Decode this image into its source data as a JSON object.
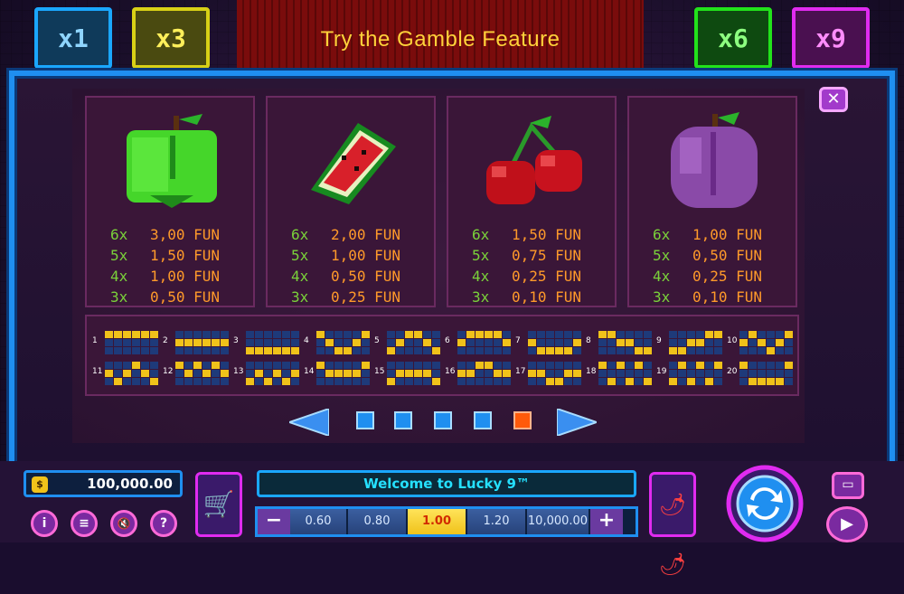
{
  "banner": {
    "text": "Try the Gamble Feature"
  },
  "multipliers": [
    {
      "label": "x1",
      "color": "#1aa7ff"
    },
    {
      "label": "x3",
      "color": "#d8d016"
    },
    {
      "label": "x6",
      "color": "#22e21b"
    },
    {
      "label": "x9",
      "color": "#e02bf0"
    }
  ],
  "symbols": [
    {
      "name": "green-apple",
      "pays": [
        {
          "count": "6x",
          "amount": "3,00 FUN"
        },
        {
          "count": "5x",
          "amount": "1,50 FUN"
        },
        {
          "count": "4x",
          "amount": "1,00 FUN"
        },
        {
          "count": "3x",
          "amount": "0,50 FUN"
        }
      ]
    },
    {
      "name": "watermelon",
      "pays": [
        {
          "count": "6x",
          "amount": "2,00 FUN"
        },
        {
          "count": "5x",
          "amount": "1,00 FUN"
        },
        {
          "count": "4x",
          "amount": "0,50 FUN"
        },
        {
          "count": "3x",
          "amount": "0,25 FUN"
        }
      ]
    },
    {
      "name": "cherries",
      "pays": [
        {
          "count": "6x",
          "amount": "1,50 FUN"
        },
        {
          "count": "5x",
          "amount": "0,75 FUN"
        },
        {
          "count": "4x",
          "amount": "0,25 FUN"
        },
        {
          "count": "3x",
          "amount": "0,10 FUN"
        }
      ]
    },
    {
      "name": "plum",
      "pays": [
        {
          "count": "6x",
          "amount": "1,00 FUN"
        },
        {
          "count": "5x",
          "amount": "0,50 FUN"
        },
        {
          "count": "4x",
          "amount": "0,25 FUN"
        },
        {
          "count": "3x",
          "amount": "0,10 FUN"
        }
      ]
    }
  ],
  "paylines": [
    "1",
    "2",
    "3",
    "4",
    "5",
    "6",
    "7",
    "8",
    "9",
    "10",
    "11",
    "12",
    "13",
    "14",
    "15",
    "16",
    "17",
    "18",
    "19",
    "20"
  ],
  "pagination": {
    "pages": 5,
    "active": 5
  },
  "balance": {
    "value": "100,000.00"
  },
  "welcome": "Welcome to Lucky 9™",
  "bets": {
    "minus": "−",
    "plus": "+",
    "values": [
      "0.60",
      "0.80",
      "1.00",
      "1.20",
      "10,000.00"
    ],
    "selected": "1.00"
  },
  "buttons": {
    "info": "i",
    "menu": "≡",
    "sound": "🔇",
    "help": "?"
  },
  "icons": {
    "cart": "cart-icon",
    "chili": "chili-icon",
    "spin": "spin-icon",
    "autoplay": "autoplay-icon",
    "chat": "chat-icon",
    "close": "close-icon"
  }
}
